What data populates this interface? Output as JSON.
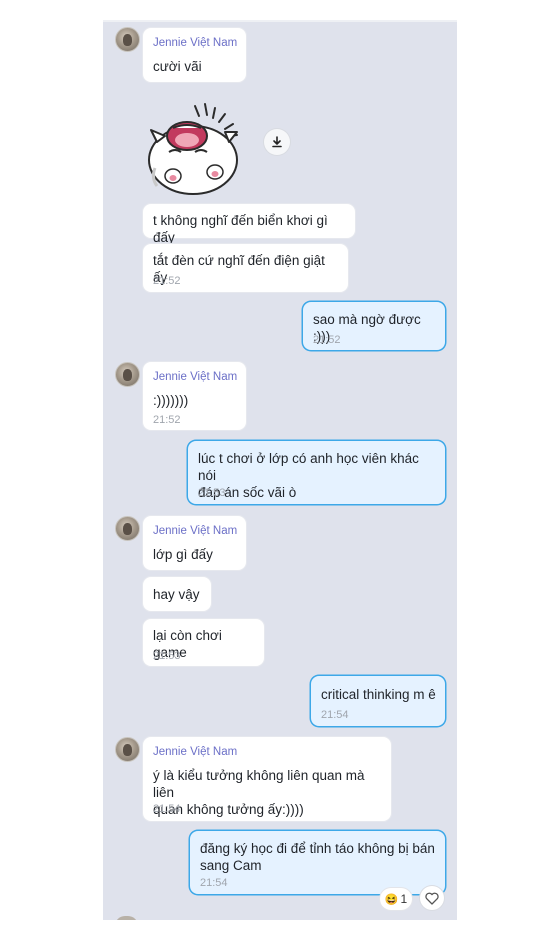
{
  "sender_name": "Jennie Việt Nam",
  "messages": {
    "m1": {
      "text": "cười vãi"
    },
    "m2": {
      "text": "t không nghĩ đến biển khơi gì đấy"
    },
    "m3": {
      "text": "tắt đèn cứ nghĩ đến điện giật ấy",
      "time": "21:52"
    },
    "m4": {
      "text": "sao mà ngờ được :)))",
      "time": "21:52"
    },
    "m5": {
      "text": ":)))))))",
      "time": "21:52"
    },
    "m6": {
      "text": "lúc t chơi ở lớp có anh học viên khác nói\nđáp án sốc vãi ò",
      "time": "21:53"
    },
    "m7": {
      "text": "lớp gì đấy"
    },
    "m8": {
      "text": "hay vậy"
    },
    "m9": {
      "text": "lại còn chơi game",
      "time": "21:53"
    },
    "m10": {
      "text": "critical thinking m ê",
      "time": "21:54"
    },
    "m11": {
      "text": "ý là kiểu tưởng không liên quan mà liên\nquan không tưởng ấy:))))",
      "time": "21:54"
    },
    "m12": {
      "text": "đăng ký học đi để tỉnh táo không bị bán\nsang Cam",
      "time": "21:54"
    }
  },
  "reaction": {
    "emoji": "😆",
    "count": "1"
  },
  "icons": {
    "download": "download-icon",
    "heart": "heart-icon",
    "sticker": "laughing-cat-sticker"
  },
  "colors": {
    "background": "#dfe2ec",
    "sent_bubble": "#e5f2ff",
    "sent_border": "#3da8e8",
    "sender_name": "#6b6fc7",
    "time": "#a0a5ad"
  }
}
